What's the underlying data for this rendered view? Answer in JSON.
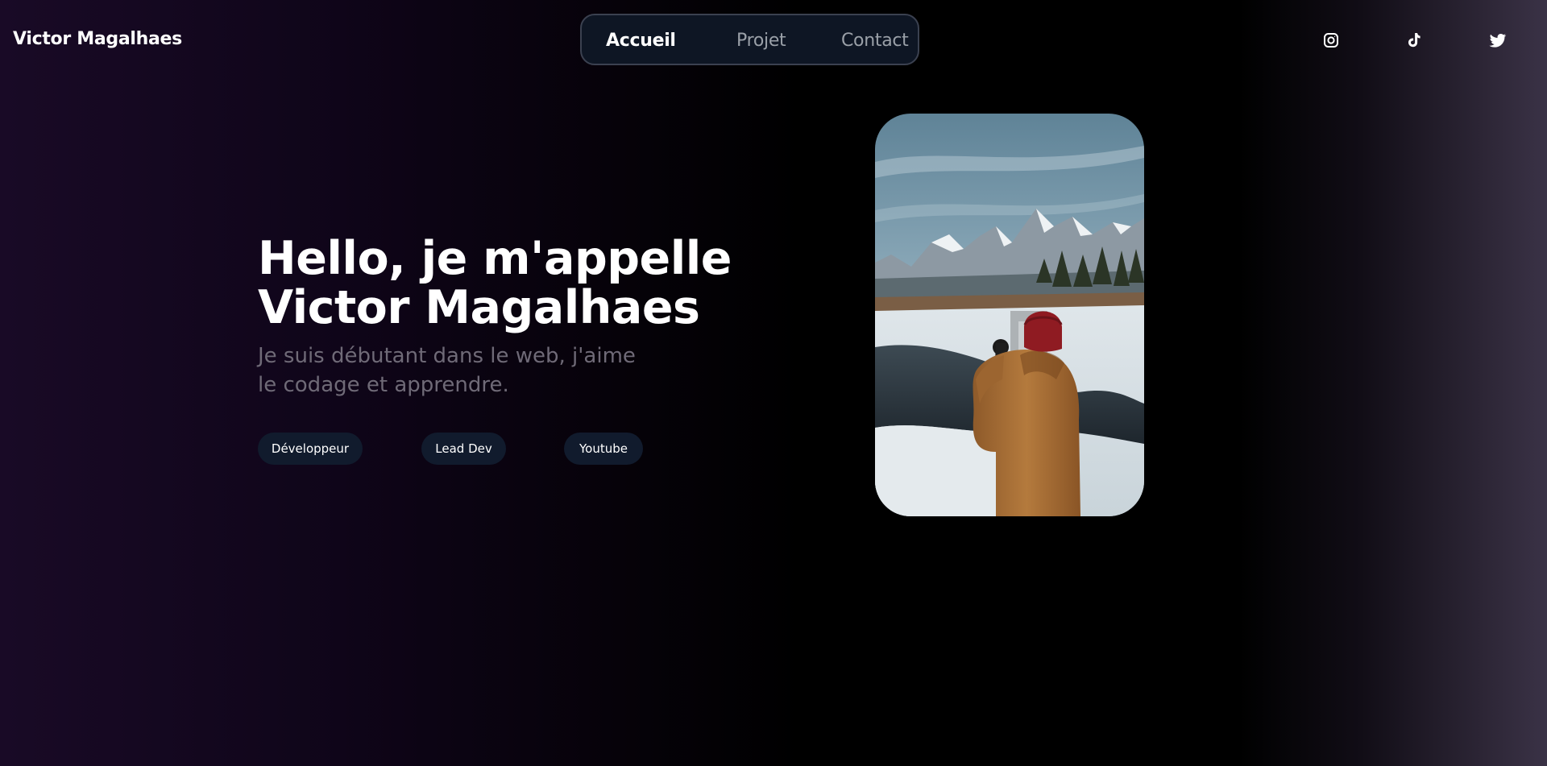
{
  "header": {
    "brand": "Victor Magalhaes",
    "nav": [
      {
        "label": "Accueil",
        "active": true
      },
      {
        "label": "Projet",
        "active": false
      },
      {
        "label": "Contact",
        "active": false
      }
    ],
    "social_icons": [
      "instagram-icon",
      "tiktok-icon",
      "twitter-icon"
    ]
  },
  "hero": {
    "title_line1": "Hello, je m'appelle",
    "title_line2": "Victor Magalhaes",
    "subtitle_line1": "Je suis débutant dans le web, j'aime",
    "subtitle_line2": "le codage et apprendre.",
    "tags": [
      "Développeur",
      "Lead Dev",
      "Youtube"
    ]
  },
  "photo": {
    "subject": "person in orange parka and red beanie photographing snowy mountains by a river"
  },
  "colors": {
    "nav_background": "#0e1624",
    "nav_border": "#3b4150",
    "tag_background": "#111b2d",
    "subtitle_text": "#6f6a77",
    "inactive_nav_text": "#9aa0a8"
  }
}
